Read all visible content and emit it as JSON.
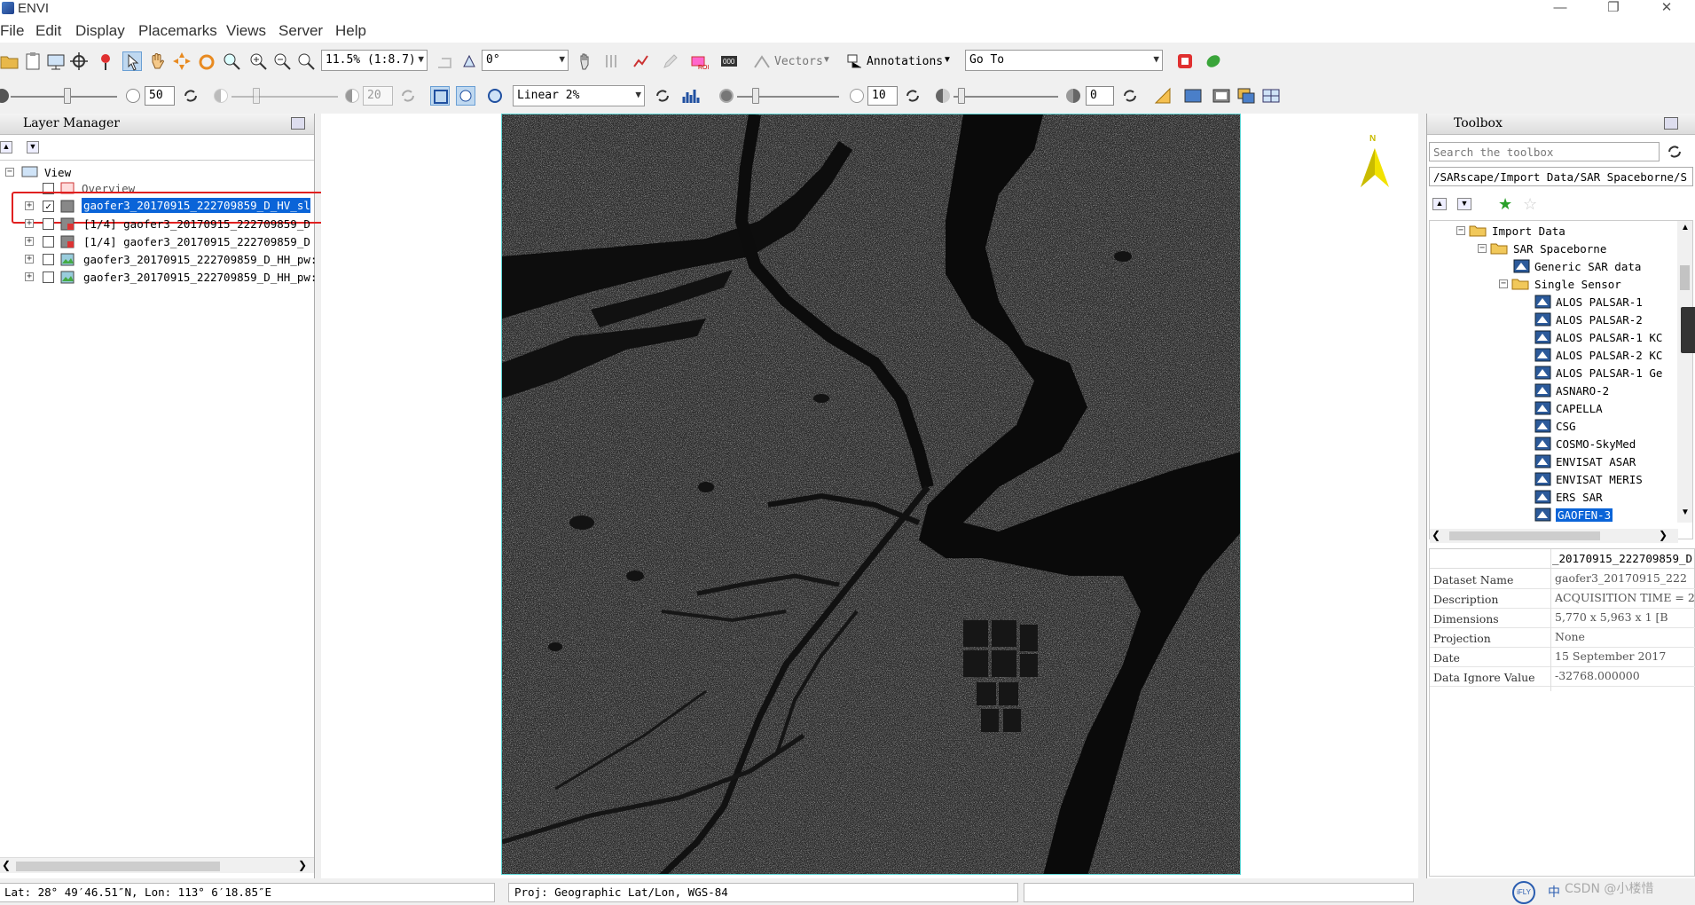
{
  "window": {
    "title": "ENVI"
  },
  "menu": [
    "File",
    "Edit",
    "Display",
    "Placemarks",
    "Views",
    "Server",
    "Help"
  ],
  "toolbar1": {
    "zoom": "11.5% (1:8.7)",
    "rotation": "0°",
    "vectors_label": "Vectors",
    "annotations_label": "Annotations",
    "goto_value": "Go To"
  },
  "toolbar2": {
    "brightness": "50",
    "contrast": "20",
    "stretch": "Linear 2%",
    "sharpen": "10",
    "transparency": "0"
  },
  "layer_manager": {
    "title": "Layer Manager",
    "root": "View",
    "overview": "Overview",
    "layers": [
      {
        "label": "gaofer3_20170915_222709859_D_HV_sl",
        "checked": true,
        "selected": true
      },
      {
        "label": "[1/4] gaofer3_20170915_222709859_D",
        "checked": false,
        "selected": false
      },
      {
        "label": "[1/4] gaofer3_20170915_222709859_D",
        "checked": false,
        "selected": false
      },
      {
        "label": "gaofer3_20170915_222709859_D_HH_pw:",
        "checked": false,
        "selected": false
      },
      {
        "label": "gaofer3_20170915_222709859_D_HH_pw:",
        "checked": false,
        "selected": false
      }
    ]
  },
  "north_arrow": {
    "label": "N"
  },
  "toolbox": {
    "title": "Toolbox",
    "search_placeholder": "Search the toolbox",
    "path": "/SARscape/Import Data/SAR Spaceborne/S",
    "tree": {
      "import_data": "Import Data",
      "sar_spaceborne": "SAR Spaceborne",
      "generic_sar": "Generic SAR data",
      "single_sensor": "Single Sensor",
      "sensors": [
        "ALOS PALSAR-1",
        "ALOS PALSAR-2",
        "ALOS PALSAR-1 KC",
        "ALOS PALSAR-2 KC",
        "ALOS PALSAR-1 Ge",
        "ASNARO-2",
        "CAPELLA",
        "CSG",
        "COSMO-SkyMed",
        "ENVISAT ASAR",
        "ENVISAT MERIS",
        "ERS SAR",
        "GAOFEN-3"
      ],
      "selected": "GAOFEN-3"
    }
  },
  "dataset_info": {
    "header": "_20170915_222709859_D",
    "rows": [
      {
        "label": "Dataset Name",
        "value": "gaofer3_20170915_222"
      },
      {
        "label": "Description",
        "value": "ACQUISITION TIME = 2"
      },
      {
        "label": "Dimensions",
        "value": "5,770 x 5,963 x 1 [B"
      },
      {
        "label": "Projection",
        "value": "None"
      },
      {
        "label": "Date",
        "value": "15 September 2017"
      },
      {
        "label": "Data Ignore Value",
        "value": "-32768.000000"
      }
    ]
  },
  "status": {
    "coords": "Lat: 28° 49′46.51″N, Lon: 113° 6′18.85″E",
    "projection": "Proj: Geographic Lat/Lon, WGS-84",
    "watermark": "CSDN @小楼惜"
  },
  "colors": {
    "selection": "#0a64d8",
    "highlight_box": "#e02020",
    "image_border": "#5fd6d6"
  }
}
